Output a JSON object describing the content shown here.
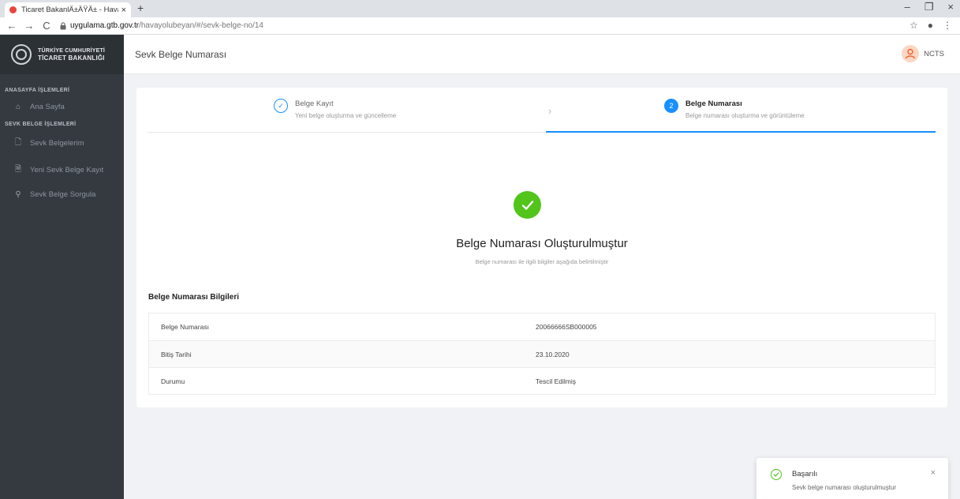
{
  "browser": {
    "tab_title": "Ticaret BakanlÄ±ÄŸÄ± - Havayo",
    "tab_close": "×",
    "new_tab": "+",
    "url_host": "uygulama.gtb.gov.tr",
    "url_path": "/havayolubeyan/#/sevk-belge-no/14",
    "controls": {
      "minimize": "–",
      "maximize": "❐",
      "close": "×"
    },
    "nav": {
      "back": "←",
      "forward": "→",
      "reload": "C"
    },
    "addr_icons": {
      "star": "☆",
      "profile": "●",
      "menu": "⋮"
    }
  },
  "sidebar": {
    "logo_line1": "TÜRKİYE CUMHURİYETİ",
    "logo_line2": "TİCARET BAKANLIĞI",
    "section1": "ANASAYFA İŞLEMLERİ",
    "section2": "SEVK BELGE İŞLEMLERİ",
    "items": [
      {
        "label": "Ana Sayfa",
        "icon": "home-icon"
      },
      {
        "label": "Sevk Belgelerim",
        "icon": "file-icon"
      },
      {
        "label": "Yeni Sevk Belge Kayıt",
        "icon": "file-add-icon"
      },
      {
        "label": "Sevk Belge Sorgula",
        "icon": "search-icon"
      }
    ]
  },
  "header": {
    "title": "Sevk Belge Numarası",
    "user_name": "NCTS"
  },
  "steps": [
    {
      "number": "✓",
      "title": "Belge Kayıt",
      "subtitle": "Yeni belge oluşturma ve güncelleme",
      "state": "done"
    },
    {
      "number": "2",
      "title": "Belge Numarası",
      "subtitle": "Belge numarası oluşturma ve görüntüleme",
      "state": "active"
    }
  ],
  "result": {
    "title": "Belge Numarası Oluşturulmuştur",
    "subtitle": "Belge numarası ile ilgili bilgiler aşağıda belirtilmiştir"
  },
  "info": {
    "title": "Belge Numarası Bilgileri",
    "rows": [
      {
        "label": "Belge Numarası",
        "value": "20066666SB000005"
      },
      {
        "label": "Bitiş Tarihi",
        "value": "23.10.2020"
      },
      {
        "label": "Durumu",
        "value": "Tescil Edilmiş"
      }
    ]
  },
  "toast": {
    "title": "Başarılı",
    "message": "Sevk belge numarası oluşturulmuştur",
    "close": "×"
  },
  "colors": {
    "primary": "#1890ff",
    "success": "#52c41a",
    "sidebar_bg": "#343a40"
  }
}
